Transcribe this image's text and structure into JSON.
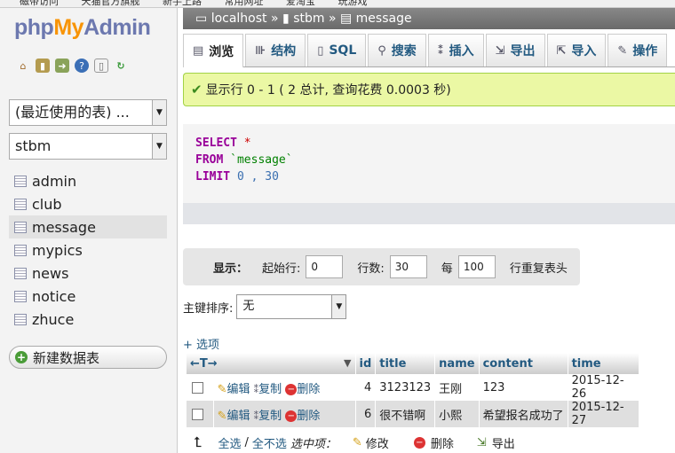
{
  "bookmarks": [
    "磁带访问",
    "天猫官方旗舰",
    "新手上路",
    "常用网址",
    "爱淘宝",
    "玩游戏"
  ],
  "logo": {
    "php": "php",
    "my": "My",
    "admin": "Admin"
  },
  "sidebar": {
    "recent_select": "(最近使用的表) ...",
    "db_select": "stbm",
    "tables": [
      {
        "name": "admin"
      },
      {
        "name": "club"
      },
      {
        "name": "message"
      },
      {
        "name": "mypics"
      },
      {
        "name": "news"
      },
      {
        "name": "notice"
      },
      {
        "name": "zhuce"
      }
    ],
    "new_table": "新建数据表"
  },
  "breadcrumb": {
    "server": "localhost",
    "sep": "»",
    "db": "stbm",
    "table": "message"
  },
  "tabs": [
    {
      "label": "浏览",
      "icon": "browse-icon"
    },
    {
      "label": "结构",
      "icon": "structure-icon"
    },
    {
      "label": "SQL",
      "icon": "sql-icon"
    },
    {
      "label": "搜索",
      "icon": "search-icon"
    },
    {
      "label": "插入",
      "icon": "insert-icon"
    },
    {
      "label": "导出",
      "icon": "export-icon"
    },
    {
      "label": "导入",
      "icon": "import-icon"
    },
    {
      "label": "操作",
      "icon": "operations-icon"
    }
  ],
  "success_msg": "显示行 0 - 1 ( 2 总计, 查询花费 0.0003 秒)",
  "sql": {
    "select": "SELECT",
    "star": "*",
    "from": "FROM",
    "table": "`message`",
    "limit": "LIMIT",
    "start": "0",
    "comma": ",",
    "count": "30"
  },
  "nav": {
    "show": "显示：",
    "start_label": "起始行:",
    "start_value": "0",
    "rows_label": "行数:",
    "rows_value": "30",
    "every": "每",
    "every_value": "100",
    "repeat": "行重复表头"
  },
  "sort": {
    "label": "主键排序:",
    "value": "无"
  },
  "options": "+ 选项",
  "table": {
    "arrows": "←T→",
    "sort_arrow": "▼",
    "headers": [
      "id",
      "title",
      "name",
      "content",
      "time"
    ],
    "actions": {
      "edit": "编辑",
      "copy": "复制",
      "delete": "删除"
    },
    "rows": [
      {
        "id": "4",
        "title": "3123123",
        "name": "王刚",
        "content": "123",
        "time": "2015-12-26"
      },
      {
        "id": "6",
        "title": "很不错啊",
        "name": "小熙",
        "content": "希望报名成功了",
        "time": "2015-12-27"
      }
    ]
  },
  "bottom": {
    "check_all": "全选",
    "slash": "/",
    "uncheck_all": "全不选",
    "with_selected": "选中项：",
    "edit": "修改",
    "delete": "删除",
    "export": "导出"
  }
}
